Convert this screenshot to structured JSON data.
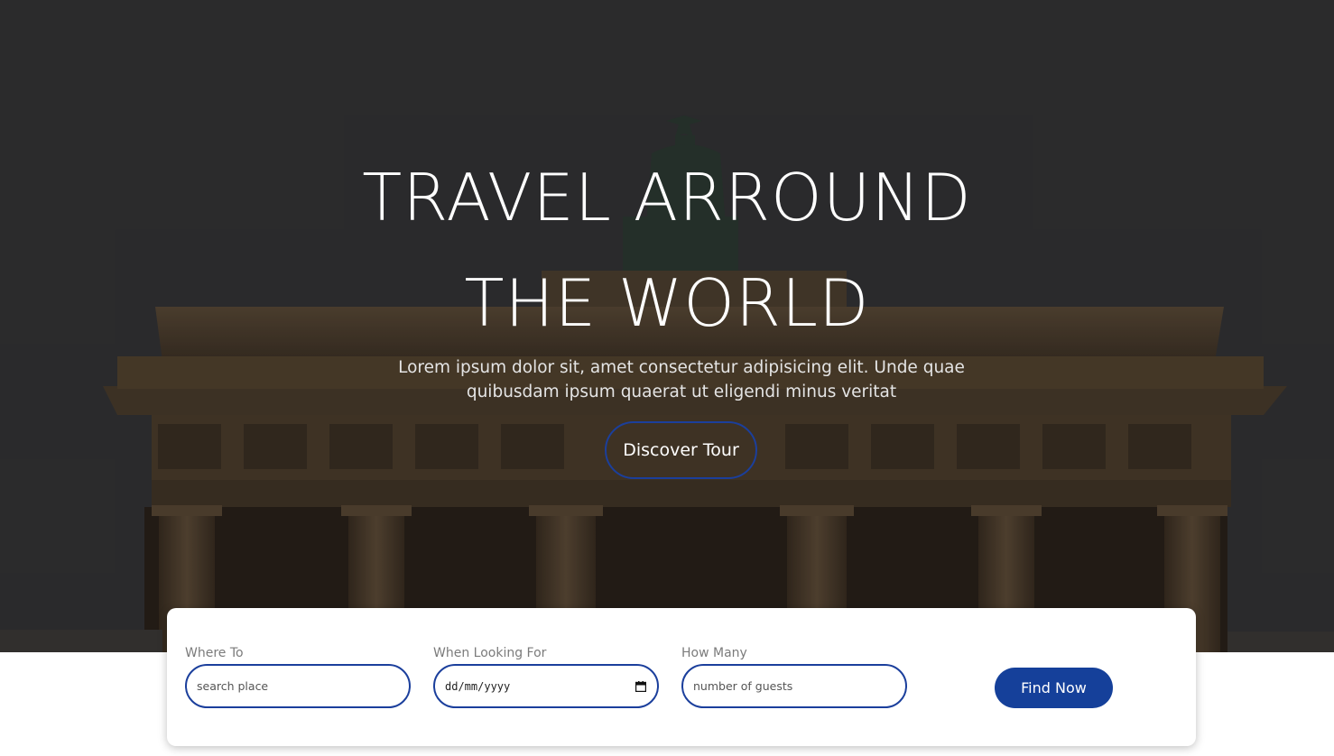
{
  "hero": {
    "title_line1": "TRAVEL ARROUND",
    "title_line2": "THE WORLD",
    "subtitle": "Lorem ipsum dolor sit, amet consectetur adipisicing elit. Unde quae quibusdam ipsum quaerat ut eligendi minus veritat",
    "cta_label": "Discover Tour",
    "background_image": "brandenburg-gate-photo"
  },
  "search": {
    "where": {
      "label": "Where To",
      "placeholder": "search place"
    },
    "when": {
      "label": "When Looking For",
      "value": "dd/mm/yyyy",
      "icon": "calendar-icon"
    },
    "guests": {
      "label": "How Many",
      "placeholder": "number of guests"
    },
    "submit_label": "Find Now"
  },
  "colors": {
    "accent": "#15409a",
    "hero_sky": "#343436",
    "card_bg": "#ffffff"
  }
}
